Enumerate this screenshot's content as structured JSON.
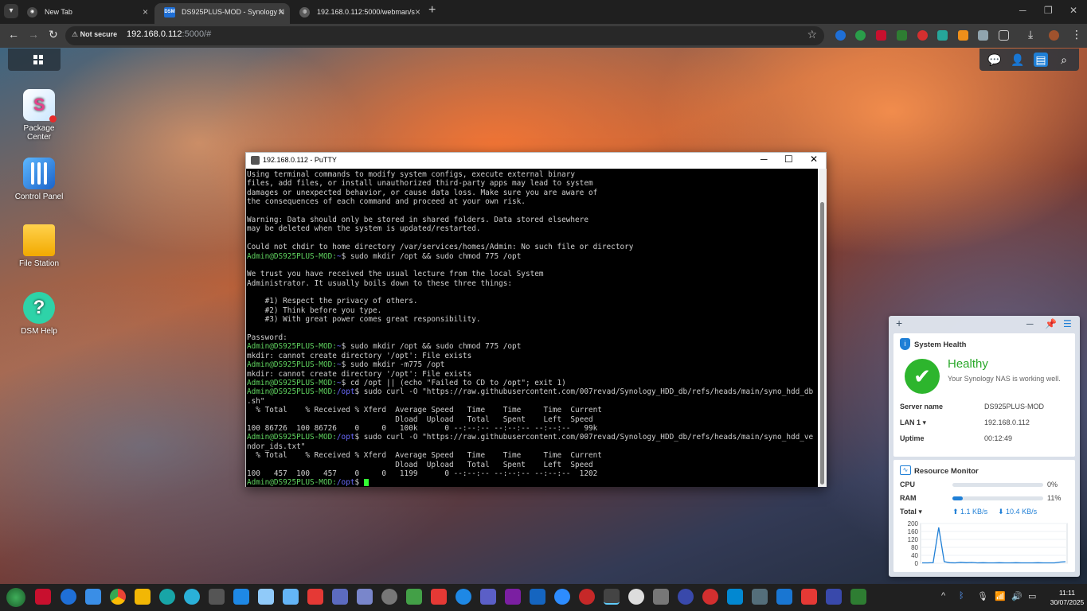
{
  "browser": {
    "tabs": [
      {
        "title": "New Tab",
        "favicon_color": "#4a4a4a"
      },
      {
        "title": "DS925PLUS-MOD - Synology N",
        "favicon_label": "DSM",
        "favicon_color": "#1f6fd6"
      },
      {
        "title": "192.168.0.112:5000/webman/s",
        "favicon_color": "#5a5a5a"
      }
    ],
    "security_label": "Not secure",
    "url_host": "192.168.0.112",
    "url_path": ":5000/#"
  },
  "desktop": {
    "icons": [
      {
        "label_line1": "Package",
        "label_line2": "Center"
      },
      {
        "label_line1": "Control Panel",
        "label_line2": ""
      },
      {
        "label_line1": "File Station",
        "label_line2": ""
      },
      {
        "label_line1": "DSM Help",
        "label_line2": ""
      }
    ]
  },
  "putty": {
    "title": "192.168.0.112 - PuTTY",
    "prompt_user": "Admin@DS925PLUS-MOD",
    "lines": [
      "Using terminal commands to modify system configs, execute external binary",
      "files, add files, or install unauthorized third-party apps may lead to system",
      "damages or unexpected behavior, or cause data loss. Make sure you are aware of",
      "the consequences of each command and proceed at your own risk.",
      "",
      "Warning: Data should only be stored in shared folders. Data stored elsewhere",
      "may be deleted when the system is updated/restarted.",
      "",
      "Could not chdir to home directory /var/services/homes/Admin: No such file or directory",
      "",
      "",
      "We trust you have received the usual lecture from the local System",
      "Administrator. It usually boils down to these three things:",
      "",
      "    #1) Respect the privacy of others.",
      "    #2) Think before you type.",
      "    #3) With great power comes great responsibility.",
      "",
      "Password:",
      "",
      "mkdir: cannot create directory '/opt': File exists",
      "",
      "mkdir: cannot create directory '/opt': File exists",
      "",
      "",
      ".sh\"",
      "  % Total    % Received % Xferd  Average Speed   Time    Time     Time  Current",
      "                                 Dload  Upload   Total   Spent    Left  Speed",
      "100 86726  100 86726    0     0   100k      0 --:--:-- --:--:-- --:--:--   99k",
      "",
      "ndor_ids.txt\"",
      "  % Total    % Received % Xferd  Average Speed   Time    Time     Time  Current",
      "                                 Dload  Upload   Total   Spent    Left  Speed",
      "100   457  100   457    0     0   1199      0 --:--:-- --:--:-- --:--:--  1202",
      ""
    ],
    "prompts": [
      {
        "line": 9,
        "dir": "~",
        "cmd": "sudo mkdir /opt && sudo chmod 775 /opt"
      },
      {
        "line": 19,
        "dir": "~",
        "cmd": "sudo mkdir /opt && sudo chmod 775 /opt"
      },
      {
        "line": 21,
        "dir": "~",
        "cmd": "sudo mkdir -m775 /opt"
      },
      {
        "line": 23,
        "dir": "~",
        "cmd": "cd /opt || (echo \"Failed to CD to /opt\"; exit 1)"
      },
      {
        "line": 24,
        "dir": "/opt",
        "cmd": "sudo curl -O \"https://raw.githubusercontent.com/007revad/Synology_HDD_db/refs/heads/main/syno_hdd_db"
      },
      {
        "line": 29,
        "dir": "/opt",
        "cmd": "sudo curl -O \"https://raw.githubusercontent.com/007revad/Synology_HDD_db/refs/heads/main/syno_hdd_ve"
      },
      {
        "line": 34,
        "dir": "/opt",
        "cmd": ""
      }
    ]
  },
  "system_health": {
    "title": "System Health",
    "status": "Healthy",
    "description": "Your Synology NAS is working well.",
    "server_name_label": "Server name",
    "server_name": "DS925PLUS-MOD",
    "lan_label": "LAN 1 ▾",
    "lan_ip": "192.168.0.112",
    "uptime_label": "Uptime",
    "uptime": "00:12:49"
  },
  "resource_monitor": {
    "title": "Resource Monitor",
    "cpu_label": "CPU",
    "cpu_value": "0%",
    "cpu_percent": 0,
    "ram_label": "RAM",
    "ram_value": "11%",
    "ram_percent": 11,
    "total_label": "Total ▾",
    "upload": "1.1 KB/s",
    "download": "10.4 KB/s",
    "chart_ticks": [
      "200",
      "160",
      "120",
      "80",
      "40",
      "0"
    ],
    "chart_max": 200,
    "chart_series": [
      2,
      2,
      3,
      180,
      8,
      3,
      2,
      5,
      3,
      4,
      2,
      3,
      2,
      2,
      3,
      2,
      2,
      3,
      2,
      2,
      2,
      3,
      2,
      2,
      2,
      6,
      8
    ]
  },
  "taskbar": {
    "clock_time": "11:11",
    "clock_date": "30/07/2025"
  }
}
